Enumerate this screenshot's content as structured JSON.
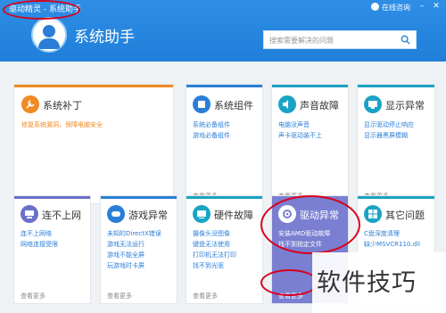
{
  "window": {
    "title": "驱动精灵 - 系统助手",
    "online_consult": "在线咨询"
  },
  "app": {
    "title": "系统助手"
  },
  "search": {
    "placeholder": "搜索需要解决的问题"
  },
  "cards": [
    {
      "title": "系统补丁",
      "desc": [
        "修复系统漏洞，保障电脑安全"
      ],
      "more": ""
    },
    {
      "title": "系统组件",
      "desc": [
        "系统必备组件",
        "游戏必备组件"
      ],
      "more": "查看更多"
    },
    {
      "title": "声音故障",
      "desc": [
        "电脑没声音",
        "声卡驱动装不上"
      ],
      "more": "查看更多"
    },
    {
      "title": "显示异常",
      "desc": [
        "显示驱动停止响应",
        "显示器黑屏模糊"
      ],
      "more": "查看更多"
    },
    {
      "title": "连不上网",
      "desc": [
        "连不上网络",
        "网络连接受限"
      ],
      "more": "查看更多"
    },
    {
      "title": "游戏异常",
      "desc": [
        "未知的DirectX错误",
        "游戏无法运行",
        "游戏不能全屏",
        "玩游戏时卡屏"
      ],
      "more": "查看更多"
    },
    {
      "title": "硬件故障",
      "desc": [
        "摄像头没图像",
        "键盘无法使用",
        "打印机无法打印",
        "找不到光驱"
      ],
      "more": "查看更多"
    },
    {
      "title": "驱动异常",
      "desc": [
        "安装AMD驱动故障",
        "找不到指定文件"
      ],
      "more": "查看更多"
    },
    {
      "title": "其它问题",
      "desc": [
        "C盘深度清理",
        "缺少MSVCR110.dll"
      ],
      "more": ""
    }
  ],
  "watermark": "软件技巧",
  "colors": {
    "header": "#1f7fd9",
    "orange": "#f08a24",
    "blue": "#2a7ed8",
    "cyan": "#1aa3c4",
    "purple": "#6b70c8",
    "highlight": "#7a7fd2"
  }
}
